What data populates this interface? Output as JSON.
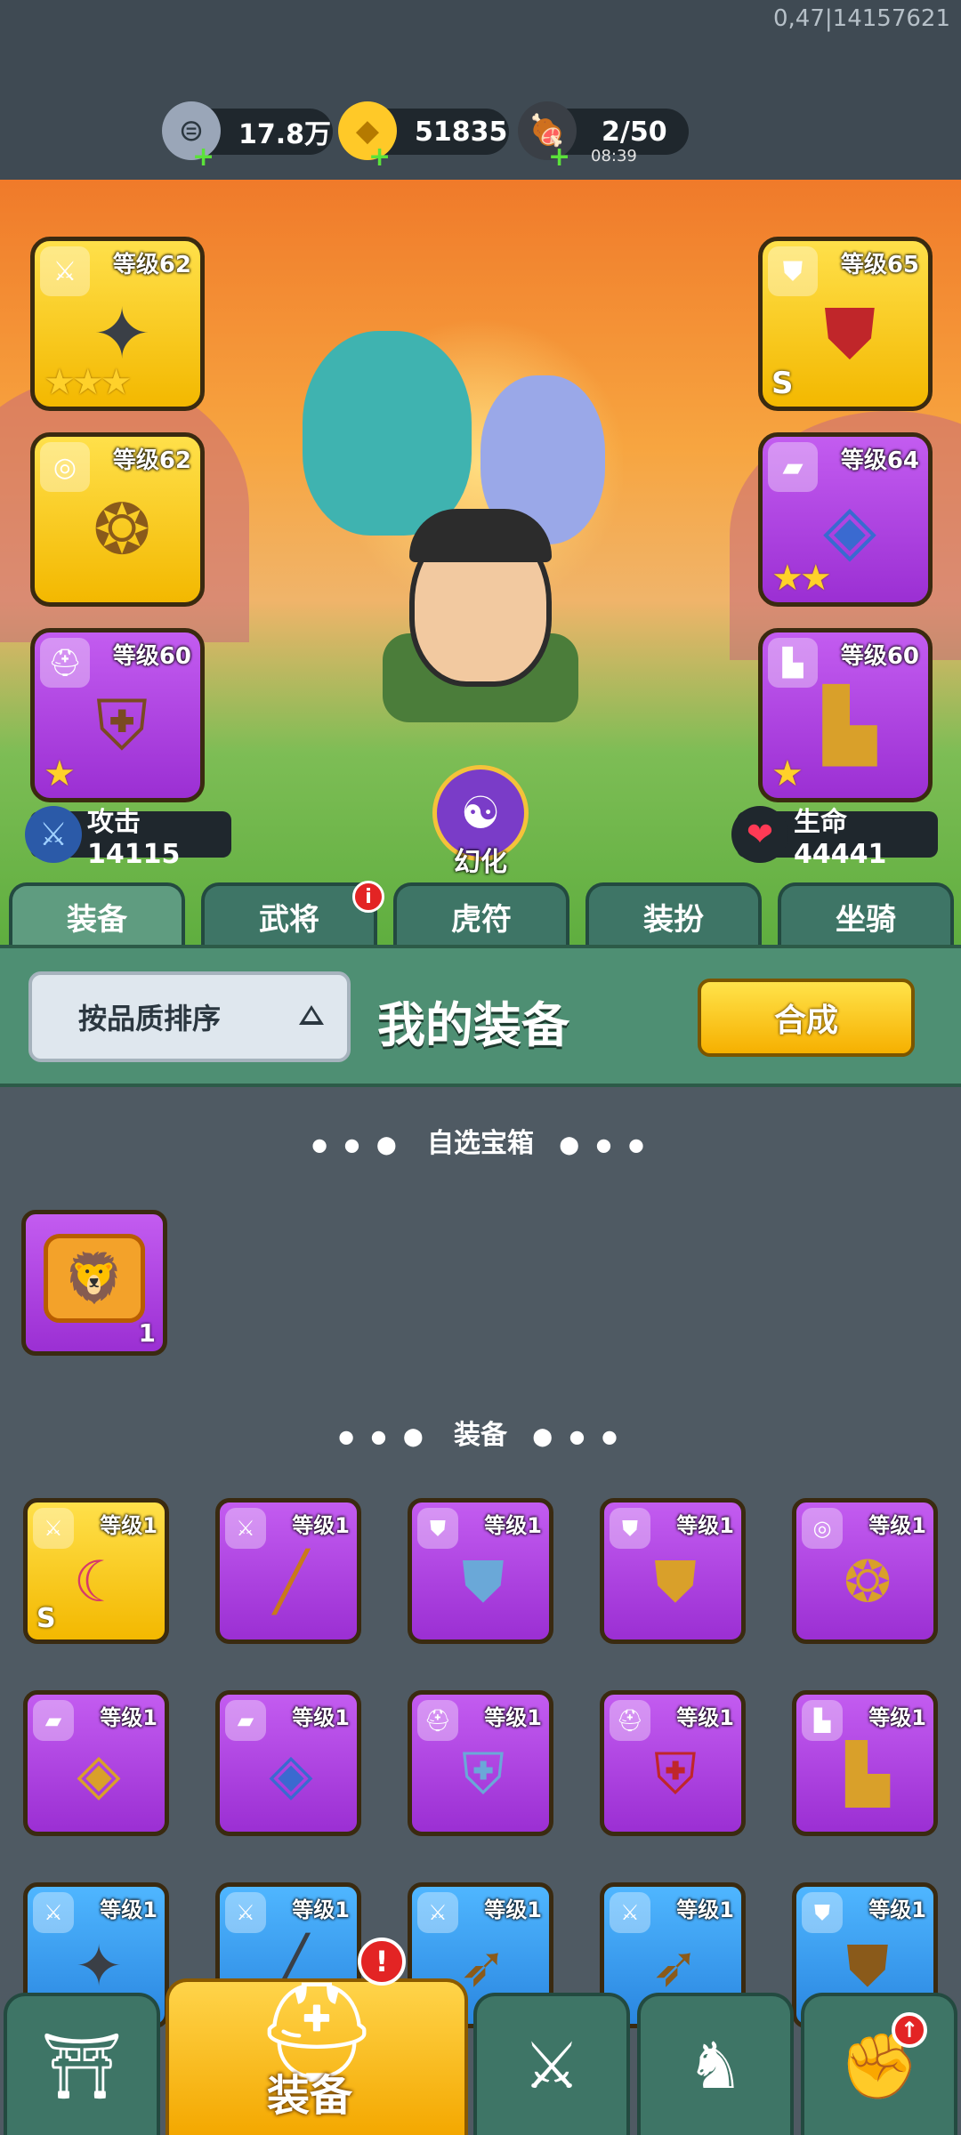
{
  "status": {
    "debug_text": "0,47|14157621"
  },
  "resources": [
    {
      "name": "silver",
      "icon": "silver-coin-icon",
      "glyph": "⊜",
      "value": "17.8万",
      "color": "#9aa6b8"
    },
    {
      "name": "gold",
      "icon": "gold-ingot-icon",
      "glyph": "◆",
      "value": "51835",
      "color": "#ffc928"
    },
    {
      "name": "stamina",
      "icon": "meat-icon",
      "glyph": "🍖",
      "value": "2/50",
      "timer": "08:39",
      "color": "#d9855a"
    }
  ],
  "hero_equipment": {
    "left": [
      {
        "slot": "weapon",
        "tag_icon": "sword-icon",
        "tag_glyph": "⚔",
        "level": "等级62",
        "art": "✦",
        "art_color": "#3a3f46",
        "quality": "gold",
        "stars": "★★★",
        "grade": ""
      },
      {
        "slot": "amulet",
        "tag_icon": "medal-icon",
        "tag_glyph": "◎",
        "level": "等级62",
        "art": "❂",
        "art_color": "#8a5a1a",
        "quality": "gold",
        "stars": "",
        "grade": ""
      },
      {
        "slot": "helmet",
        "tag_icon": "helmet-icon",
        "tag_glyph": "⛑",
        "level": "等级60",
        "art": "⛨",
        "art_color": "#7a4a22",
        "quality": "purple",
        "stars": "★",
        "grade": ""
      }
    ],
    "right": [
      {
        "slot": "armor",
        "tag_icon": "armor-icon",
        "tag_glyph": "⛊",
        "level": "等级65",
        "art": "⛊",
        "art_color": "#c0262a",
        "quality": "gold",
        "stars": "",
        "grade": "S"
      },
      {
        "slot": "bracer",
        "tag_icon": "bracer-icon",
        "tag_glyph": "▰",
        "level": "等级64",
        "art": "◈",
        "art_color": "#3a6ad0",
        "quality": "purple",
        "stars": "★★",
        "grade": ""
      },
      {
        "slot": "boots",
        "tag_icon": "boot-icon",
        "tag_glyph": "▙",
        "level": "等级60",
        "art": "▙",
        "art_color": "#d9a02a",
        "quality": "purple",
        "stars": "★",
        "grade": ""
      }
    ]
  },
  "stats": {
    "attack": {
      "icon": "sword-icon",
      "text": "攻击 14115",
      "color": "#4aa3ff"
    },
    "hp": {
      "icon": "heart-icon",
      "text": "生命 44441",
      "color": "#ff3a55"
    }
  },
  "transform": {
    "label": "幻化",
    "icon": "transform-spirit-icon"
  },
  "tabs": [
    {
      "label": "装备",
      "active": true,
      "badge": ""
    },
    {
      "label": "武将",
      "active": false,
      "badge": "i"
    },
    {
      "label": "虎符",
      "active": false,
      "badge": ""
    },
    {
      "label": "装扮",
      "active": false,
      "badge": ""
    },
    {
      "label": "坐骑",
      "active": false,
      "badge": ""
    }
  ],
  "panel": {
    "sort_label": "按品质排序",
    "title": "我的装备",
    "merge_label": "合成"
  },
  "sections": {
    "chest_title": "自选宝箱",
    "equip_title": "装备"
  },
  "chest": {
    "count": "1",
    "icon": "treasure-chest-icon"
  },
  "inventory": [
    {
      "tag_icon": "sword-icon",
      "tag_glyph": "⚔",
      "level": "等级1",
      "art": "☾",
      "art_color": "#d63a6a",
      "quality": "gold",
      "grade": "S"
    },
    {
      "tag_icon": "sword-icon",
      "tag_glyph": "⚔",
      "level": "等级1",
      "art": "╱",
      "art_color": "#c97a1a",
      "quality": "purple",
      "grade": ""
    },
    {
      "tag_icon": "armor-icon",
      "tag_glyph": "⛊",
      "level": "等级1",
      "art": "⛊",
      "art_color": "#6aa8d8",
      "quality": "purple",
      "grade": ""
    },
    {
      "tag_icon": "armor-icon",
      "tag_glyph": "⛊",
      "level": "等级1",
      "art": "⛊",
      "art_color": "#d9a02a",
      "quality": "purple",
      "grade": ""
    },
    {
      "tag_icon": "medal-icon",
      "tag_glyph": "◎",
      "level": "等级1",
      "art": "❂",
      "art_color": "#d9a02a",
      "quality": "purple",
      "grade": ""
    },
    {
      "tag_icon": "bracer-icon",
      "tag_glyph": "▰",
      "level": "等级1",
      "art": "◈",
      "art_color": "#d9a02a",
      "quality": "purple",
      "grade": ""
    },
    {
      "tag_icon": "bracer-icon",
      "tag_glyph": "▰",
      "level": "等级1",
      "art": "◈",
      "art_color": "#3a6ad0",
      "quality": "purple",
      "grade": ""
    },
    {
      "tag_icon": "helmet-icon",
      "tag_glyph": "⛑",
      "level": "等级1",
      "art": "⛨",
      "art_color": "#6aa8d8",
      "quality": "purple",
      "grade": ""
    },
    {
      "tag_icon": "helmet-icon",
      "tag_glyph": "⛑",
      "level": "等级1",
      "art": "⛨",
      "art_color": "#c0262a",
      "quality": "purple",
      "grade": ""
    },
    {
      "tag_icon": "boot-icon",
      "tag_glyph": "▙",
      "level": "等级1",
      "art": "▙",
      "art_color": "#d9a02a",
      "quality": "purple",
      "grade": ""
    },
    {
      "tag_icon": "sword-icon",
      "tag_glyph": "⚔",
      "level": "等级1",
      "art": "✦",
      "art_color": "#3a3f46",
      "quality": "blue",
      "grade": ""
    },
    {
      "tag_icon": "sword-icon",
      "tag_glyph": "⚔",
      "level": "等级1",
      "art": "╱",
      "art_color": "#3a3f46",
      "quality": "blue",
      "grade": ""
    },
    {
      "tag_icon": "sword-icon",
      "tag_glyph": "⚔",
      "level": "等级1",
      "art": "➶",
      "art_color": "#8a5a1a",
      "quality": "blue",
      "grade": ""
    },
    {
      "tag_icon": "sword-icon",
      "tag_glyph": "⚔",
      "level": "等级1",
      "art": "➶",
      "art_color": "#8a5a1a",
      "quality": "blue",
      "grade": ""
    },
    {
      "tag_icon": "armor-icon",
      "tag_glyph": "⛊",
      "level": "等级1",
      "art": "⛊",
      "art_color": "#8a5a1a",
      "quality": "blue",
      "grade": ""
    }
  ],
  "bottom_nav": [
    {
      "name": "city",
      "icon": "city-gate-icon",
      "glyph": "⛩",
      "label": "",
      "active": false
    },
    {
      "name": "equipment",
      "icon": "helmet-icon",
      "glyph": "⛑",
      "label": "装备",
      "active": true
    },
    {
      "name": "battle",
      "icon": "crossed-swords-icon",
      "glyph": "⚔",
      "label": "",
      "active": false
    },
    {
      "name": "rank",
      "icon": "horn-icon",
      "glyph": "♞",
      "label": "",
      "active": false
    },
    {
      "name": "upgrade",
      "icon": "fist-upgrade-icon",
      "glyph": "✊",
      "label": "",
      "active": false
    }
  ],
  "alerts": {
    "equipment_alert": "!",
    "upgrade_alert": "↑"
  }
}
